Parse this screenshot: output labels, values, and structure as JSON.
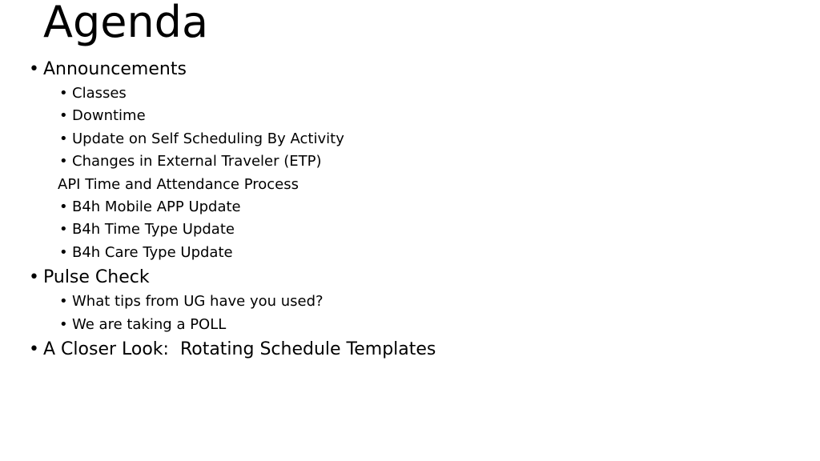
{
  "slide": {
    "title": "Agenda",
    "background_color": "#ffffff",
    "text_color": "#000000",
    "bullet_glyph": "•",
    "content": [
      {
        "level": 1,
        "bulleted": true,
        "text": "Announcements"
      },
      {
        "level": 2,
        "bulleted": true,
        "text": "Classes"
      },
      {
        "level": 2,
        "bulleted": true,
        "text": "Downtime"
      },
      {
        "level": 2,
        "bulleted": true,
        "text": "Update on Self Scheduling By Activity"
      },
      {
        "level": 2,
        "bulleted": true,
        "text": "Changes in External Traveler (ETP)"
      },
      {
        "level": 2,
        "bulleted": false,
        "text": "API Time and Attendance Process"
      },
      {
        "level": 2,
        "bulleted": true,
        "text": "B4h Mobile APP Update"
      },
      {
        "level": 2,
        "bulleted": true,
        "text": "B4h Time Type Update"
      },
      {
        "level": 2,
        "bulleted": true,
        "text": "B4h Care Type Update"
      },
      {
        "level": 1,
        "bulleted": true,
        "text": "Pulse Check"
      },
      {
        "level": 2,
        "bulleted": true,
        "text": "What tips from UG have you used?"
      },
      {
        "level": 2,
        "bulleted": true,
        "text": "We are taking a POLL"
      },
      {
        "level": 1,
        "bulleted": true,
        "text": "A Closer Look:  Rotating Schedule Templates"
      }
    ]
  }
}
